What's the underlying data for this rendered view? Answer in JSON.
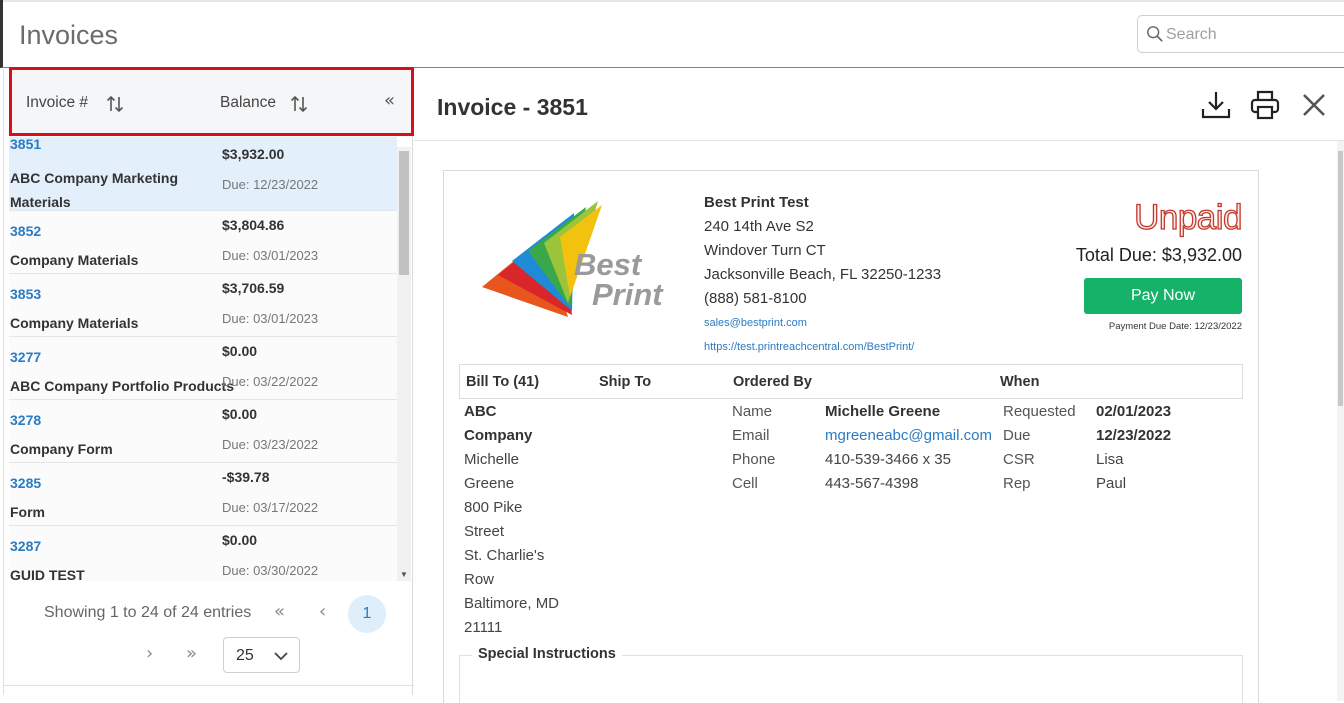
{
  "app": {
    "title": "Invoices"
  },
  "search": {
    "placeholder": "Search"
  },
  "list": {
    "columns": {
      "invoice": "Invoice #",
      "balance": "Balance"
    },
    "collapse_glyph": "«",
    "rows": [
      {
        "number": "3851",
        "name": "ABC Company Marketing Materials",
        "balance": "$3,932.00",
        "due": "Due: 12/23/2022",
        "selected": true
      },
      {
        "number": "3852",
        "name": "Company Materials",
        "balance": "$3,804.86",
        "due": "Due: 03/01/2023"
      },
      {
        "number": "3853",
        "name": "Company Materials",
        "balance": "$3,706.59",
        "due": "Due: 03/01/2023"
      },
      {
        "number": "3277",
        "name": "ABC Company Portfolio Products",
        "balance": "$0.00",
        "due": "Due: 03/22/2022"
      },
      {
        "number": "3278",
        "name": "Company Form",
        "balance": "$0.00",
        "due": "Due: 03/23/2022"
      },
      {
        "number": "3285",
        "name": "Form",
        "balance": "-$39.78",
        "due": "Due: 03/17/2022"
      },
      {
        "number": "3287",
        "name": "GUID TEST",
        "balance": "$0.00",
        "due": "Due: 03/30/2022"
      }
    ],
    "pager": {
      "info": "Showing 1 to 24 of 24 entries",
      "first": "«",
      "prev": "‹",
      "current": "1",
      "next": "›",
      "last": "»",
      "per_page": "25"
    }
  },
  "detail": {
    "title": "Invoice - 3851",
    "icons": [
      "download-icon",
      "print-icon",
      "close-icon"
    ],
    "company": {
      "logo_text_1": "Best",
      "logo_text_2": "Print",
      "name": "Best Print Test",
      "address1": "240 14th Ave S2",
      "address2": "Windover Turn CT",
      "city": "Jacksonville Beach, FL 32250-1233",
      "phone": "(888) 581-8100",
      "email": "sales@bestprint.com",
      "url": "https://test.printreachcentral.com/BestPrint/"
    },
    "status": "Unpaid",
    "total_due": "Total Due: $3,932.00",
    "pay_now": "Pay Now",
    "payment_due": "Payment Due Date: 12/23/2022",
    "sections": {
      "bill_to": "Bill To (41)",
      "ship_to": "Ship To",
      "ordered_by": "Ordered By",
      "when": "When"
    },
    "bill_to": {
      "company_line1": "ABC",
      "company_line2": "Company",
      "lines": [
        "Michelle",
        "Greene",
        "800 Pike",
        "Street",
        "St. Charlie's",
        "Row",
        "Baltimore, MD",
        "21111"
      ]
    },
    "ordered_by": {
      "name_label": "Name",
      "name": "Michelle Greene",
      "email_label": "Email",
      "email": "mgreeneabc@gmail.com",
      "phone_label": "Phone",
      "phone": "410-539-3466 x 35",
      "cell_label": "Cell",
      "cell": "443-567-4398"
    },
    "when": {
      "requested_label": "Requested",
      "requested": "02/01/2023",
      "due_label": "Due",
      "due": "12/23/2022",
      "csr_label": "CSR",
      "csr": "Lisa",
      "rep_label": "Rep",
      "rep": "Paul"
    },
    "special_instructions": "Special Instructions"
  },
  "colors": {
    "accent": "#2a7bc4",
    "pay_button": "#17b26a",
    "highlight_border": "#d80f1a",
    "unpaid": "#c0392b"
  }
}
